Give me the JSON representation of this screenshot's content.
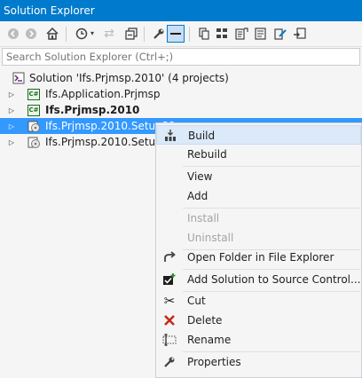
{
  "window": {
    "title": "Solution Explorer"
  },
  "toolbar": {
    "items": [
      "back-icon",
      "forward-icon",
      "home-icon",
      "history-icon",
      "sync-icon",
      "collapse-all-icon",
      "properties-icon",
      "pending-changes-filter-icon",
      "show-all-files-icon",
      "refresh-icon",
      "view-code-icon",
      "view-designer-icon",
      "edit-icon",
      "preview-icon"
    ]
  },
  "search": {
    "placeholder": "Search Solution Explorer (Ctrl+;)"
  },
  "tree": {
    "solution": "Solution 'Ifs.Prjmsp.2010' (4 projects)",
    "items": [
      {
        "label": "Ifs.Application.Prjmsp",
        "icon": "csharp-project-icon"
      },
      {
        "label": "Ifs.Prjmsp.2010",
        "icon": "csharp-project-icon",
        "bold": true
      },
      {
        "label": "Ifs.Prjmsp.2010.Setup32",
        "icon": "setup-project-icon",
        "selected": true
      },
      {
        "label": "Ifs.Prjmsp.2010.Setup64",
        "icon": "setup-project-icon"
      }
    ]
  },
  "context_menu": {
    "build": "Build",
    "rebuild": "Rebuild",
    "view": "View",
    "add": "Add",
    "install": "Install",
    "uninstall": "Uninstall",
    "open_folder": "Open Folder in File Explorer",
    "add_source_control": "Add Solution to Source Control...",
    "cut": "Cut",
    "delete": "Delete",
    "rename": "Rename",
    "properties": "Properties"
  },
  "colors": {
    "accent": "#007acc",
    "selection": "#3399ff",
    "menu_highlight": "#dbe9f8",
    "delete_red": "#c42b1c",
    "csharp_green": "#1e6b1e"
  }
}
